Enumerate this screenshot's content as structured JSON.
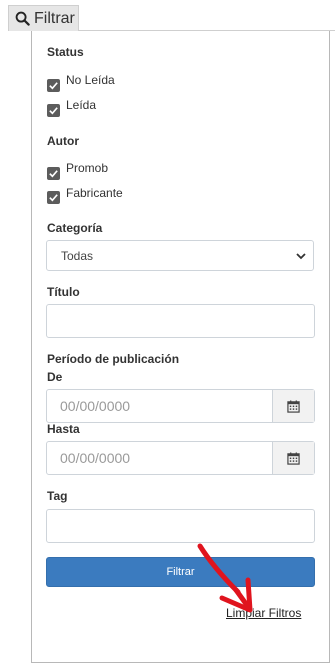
{
  "tab": {
    "label": "Filtrar",
    "icon": "search-icon"
  },
  "status": {
    "title": "Status",
    "options": [
      {
        "label": "No Leída",
        "checked": true
      },
      {
        "label": "Leída",
        "checked": true
      }
    ]
  },
  "autor": {
    "title": "Autor",
    "options": [
      {
        "label": "Promob",
        "checked": true
      },
      {
        "label": "Fabricante",
        "checked": true
      }
    ]
  },
  "categoria": {
    "title": "Categoría",
    "selected": "Todas"
  },
  "titulo": {
    "title": "Título",
    "value": ""
  },
  "periodo": {
    "title": "Período de publicación",
    "de_label": "De",
    "de_placeholder": "00/00/0000",
    "hasta_label": "Hasta",
    "hasta_placeholder": "00/00/0000"
  },
  "tag": {
    "title": "Tag",
    "value": ""
  },
  "actions": {
    "filter_label": "Filtrar",
    "clear_label": "Limpiar Filtros"
  },
  "colors": {
    "primary": "#3b7bbf",
    "annotation_arrow": "#e0141e"
  }
}
